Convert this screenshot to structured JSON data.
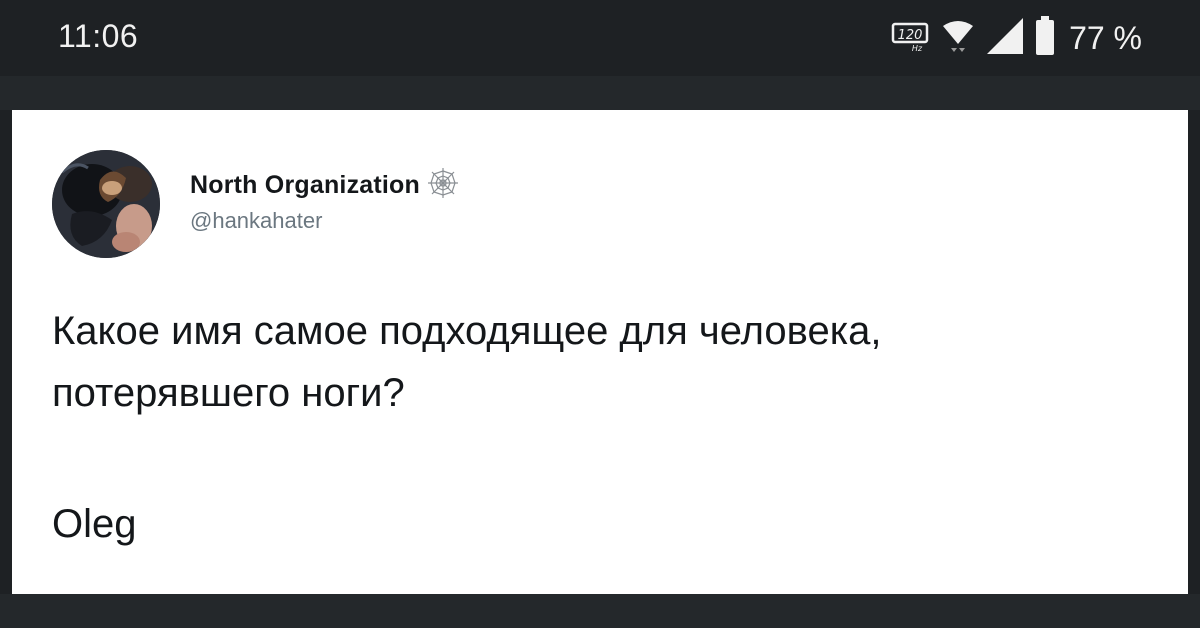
{
  "status_bar": {
    "time": "11:06",
    "refresh_badge": "120",
    "refresh_unit": "Hz",
    "battery_percent": "77 %",
    "icons": [
      "refresh-rate-icon",
      "wifi-icon",
      "signal-icon",
      "battery-icon"
    ]
  },
  "tweet": {
    "display_name": "North Organization",
    "handle": "@hankahater",
    "badge_icon": "spiderweb-icon",
    "text_lines": [
      "Какое имя самое подходящее для человека,",
      "потерявшего ноги?"
    ],
    "answer": "Oleg"
  },
  "colors": {
    "status_bg": "#1e2124",
    "card_bg": "#ffffff",
    "text": "#14171a",
    "muted": "#6b7780"
  }
}
